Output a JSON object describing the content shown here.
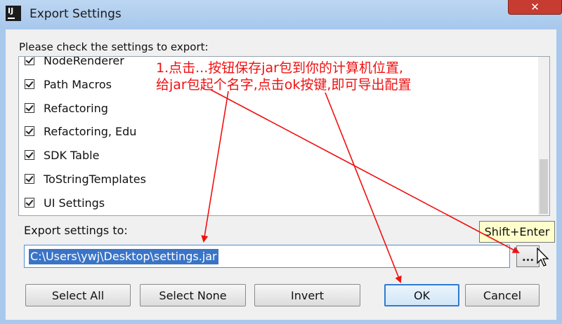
{
  "window": {
    "title": "Export Settings",
    "app_icon_text": "IJ",
    "close_glyph": "✕"
  },
  "dialog": {
    "prompt": "Please check the settings to export:",
    "items": [
      {
        "label": "NodeRenderer",
        "checked": true
      },
      {
        "label": "Path Macros",
        "checked": true
      },
      {
        "label": "Refactoring",
        "checked": true
      },
      {
        "label": "Refactoring, Edu",
        "checked": true
      },
      {
        "label": "SDK Table",
        "checked": true
      },
      {
        "label": "ToStringTemplates",
        "checked": true
      },
      {
        "label": "UI Settings",
        "checked": true
      }
    ],
    "export_label": "Export settings to:",
    "export_path": "C:\\Users\\ywj\\Desktop\\settings.jar",
    "browse_label": "...",
    "tooltip": "Shift+Enter",
    "buttons": {
      "select_all": "Select All",
      "select_none": "Select None",
      "invert": "Invert",
      "ok": "OK",
      "cancel": "Cancel"
    }
  },
  "annotation": {
    "line1": "1.点击...按钮保存jar包到你的计算机位置,",
    "line2": "给jar包起个名字,点击ok按键,即可导出配置",
    "color": "#f01010"
  },
  "colors": {
    "title_bar": "#bcd6f2",
    "close_button": "#c63c31",
    "selection": "#3a74c7",
    "tooltip_bg": "#ffffcc",
    "ok_border": "#2f7ad1"
  },
  "icons": {
    "app": "intellij-icon",
    "close": "close-icon",
    "checkbox": "check-icon",
    "cursor": "mouse-pointer-icon"
  }
}
